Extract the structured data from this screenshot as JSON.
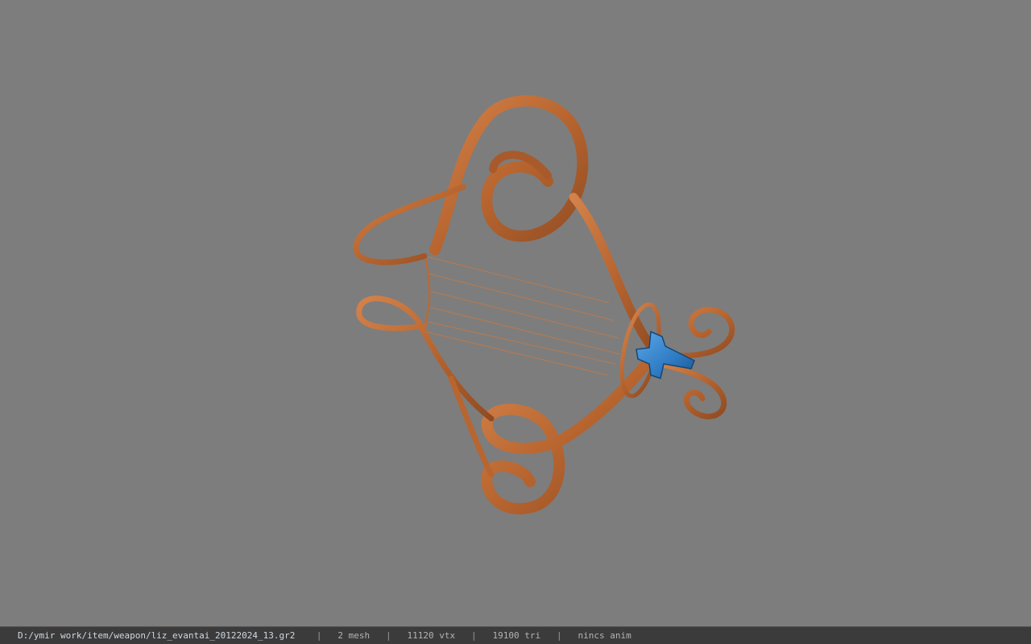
{
  "viewport": {
    "background_color": "#7d7d7d",
    "model": {
      "description_icon": "harp-fan-model",
      "frame_color": "#c0703a",
      "string_color": "#c07a48",
      "gem_color": "#2f7cc4"
    }
  },
  "status_bar": {
    "file_path": "D:/ymir work/item/weapon/liz_evantai_20122024_13.gr2",
    "mesh_count": "2 mesh",
    "vertex_count": "11120 vtx",
    "triangle_count": "19100 tri",
    "animation": "nincs anim",
    "separator": "|"
  }
}
